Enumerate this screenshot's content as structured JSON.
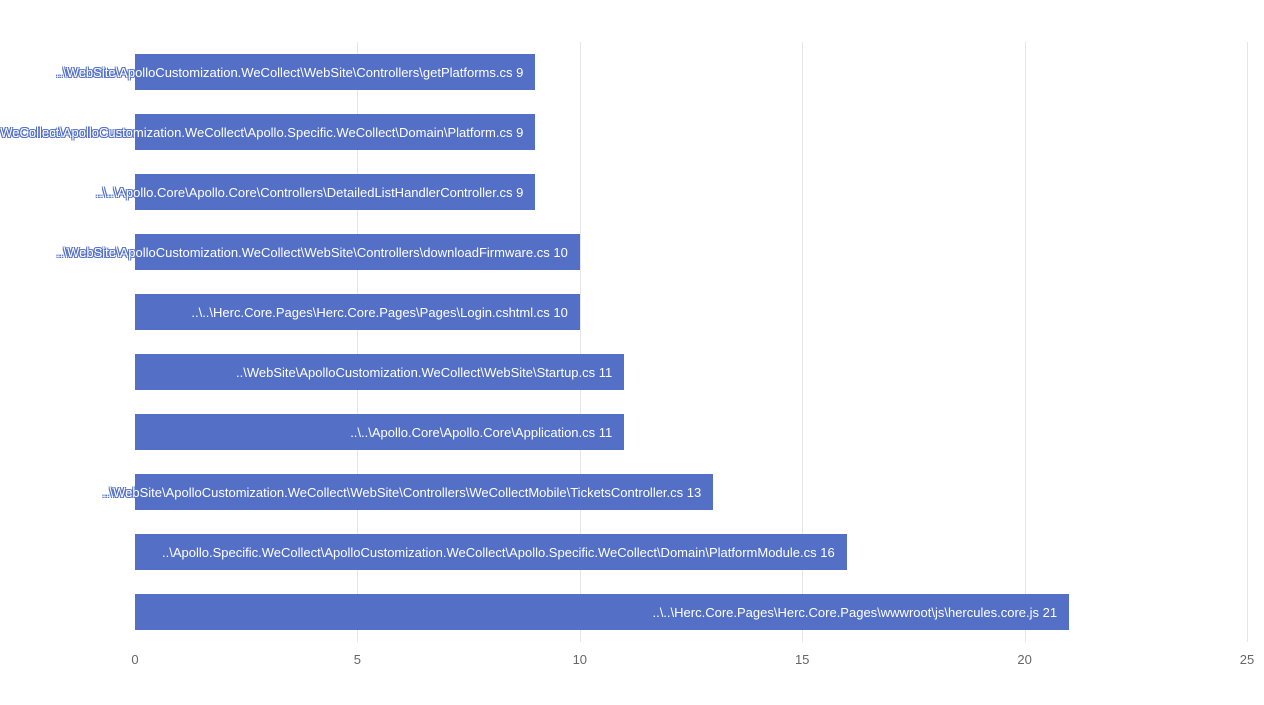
{
  "chart_data": {
    "type": "bar",
    "orientation": "horizontal",
    "xlim": [
      0,
      25
    ],
    "xticks": [
      0,
      5,
      10,
      15,
      20,
      25
    ],
    "bar_color": "#5470c6",
    "label_color": "#ffffff",
    "series": [
      {
        "label": "..\\WebSite\\ApolloCustomization.WeCollect\\WebSite\\Controllers\\getPlatforms.cs",
        "value": 9
      },
      {
        "label": "..\\Apollo.Specific.WeCollect\\ApolloCustomization.WeCollect\\Apollo.Specific.WeCollect\\Domain\\Platform.cs",
        "value": 9
      },
      {
        "label": "..\\..\\Apollo.Core\\Apollo.Core\\Controllers\\DetailedListHandlerController.cs",
        "value": 9
      },
      {
        "label": "..\\WebSite\\ApolloCustomization.WeCollect\\WebSite\\Controllers\\downloadFirmware.cs",
        "value": 10
      },
      {
        "label": "..\\..\\Herc.Core.Pages\\Herc.Core.Pages\\Pages\\Login.cshtml.cs",
        "value": 10
      },
      {
        "label": "..\\WebSite\\ApolloCustomization.WeCollect\\WebSite\\Startup.cs",
        "value": 11
      },
      {
        "label": "..\\..\\Apollo.Core\\Apollo.Core\\Application.cs",
        "value": 11
      },
      {
        "label": "..\\WebSite\\ApolloCustomization.WeCollect\\WebSite\\Controllers\\WeCollectMobile\\TicketsController.cs",
        "value": 13
      },
      {
        "label": "..\\Apollo.Specific.WeCollect\\ApolloCustomization.WeCollect\\Apollo.Specific.WeCollect\\Domain\\PlatformModule.cs",
        "value": 16
      },
      {
        "label": "..\\..\\Herc.Core.Pages\\Herc.Core.Pages\\wwwroot\\js\\hercules.core.js",
        "value": 21
      }
    ]
  }
}
